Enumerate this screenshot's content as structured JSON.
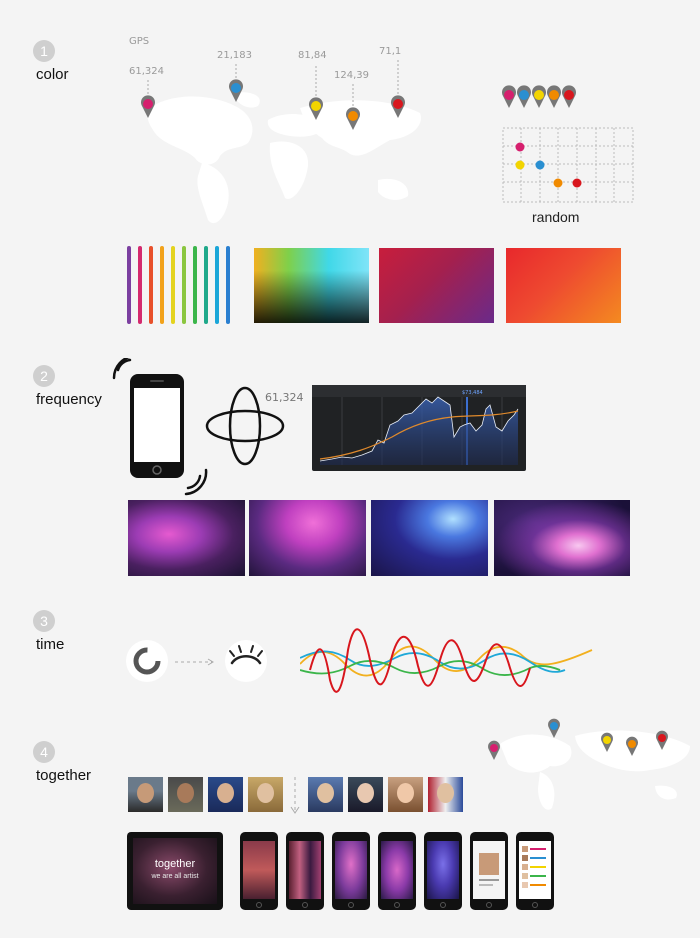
{
  "sections": [
    {
      "number": "1",
      "title": "color"
    },
    {
      "number": "2",
      "title": "frequency"
    },
    {
      "number": "3",
      "title": "time"
    },
    {
      "number": "4",
      "title": "together"
    }
  ],
  "color_section": {
    "gps_label": "GPS",
    "pins": [
      {
        "value": "61,324",
        "color": "#d61f6e"
      },
      {
        "value": "21,183",
        "color": "#2a8fd1"
      },
      {
        "value": "81,84",
        "color": "#f2d400"
      },
      {
        "value": "124,39",
        "color": "#f08a00"
      },
      {
        "value": "71,1",
        "color": "#d8161d"
      }
    ],
    "random_label": "random",
    "random_pin_colors": [
      "#d61f6e",
      "#2a8fd1",
      "#f2d400",
      "#f08a00",
      "#d8161d"
    ],
    "stripe_colors": [
      "#7b3fa0",
      "#d42a6e",
      "#e8502a",
      "#f2a21a",
      "#e4d31f",
      "#8bc63f",
      "#3bb54a",
      "#1fa88a",
      "#1aa6d8",
      "#2a7fd0"
    ]
  },
  "frequency_section": {
    "rotation_value": "61,324",
    "chart_header": "$73,484"
  },
  "together_section": {
    "tablet_title": "together",
    "tablet_subtitle": "we are all artist"
  }
}
